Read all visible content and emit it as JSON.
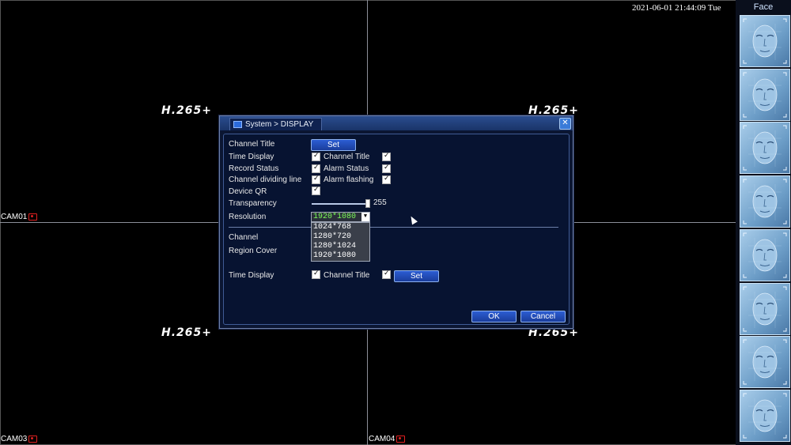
{
  "clock": "2021-06-01 21:44:09 Tue",
  "codec_label": "H.265+",
  "cameras": [
    "CAM01",
    "CAM03",
    "CAM04"
  ],
  "face_panel": {
    "title": "Face",
    "count": 8
  },
  "dialog": {
    "title": "System > DISPLAY",
    "rows": {
      "channel_title": "Channel Title",
      "set_label": "Set",
      "time_display": "Time Display",
      "channel_title_2": "Channel Title",
      "record_status": "Record Status",
      "alarm_status": "Alarm Status",
      "channel_dividing_line": "Channel dividing line",
      "alarm_flashing": "Alarm flashing",
      "device_qr": "Device QR",
      "transparency": "Transparency",
      "transparency_value": "255",
      "transparency_level": 1.0,
      "resolution": "Resolution",
      "resolution_value": "1920*1080",
      "resolution_options": [
        "1024*768",
        "1280*720",
        "1280*1024",
        "1920*1080"
      ],
      "channel": "Channel",
      "region_cover": "Region Cover",
      "time_display_2": "Time Display",
      "channel_title_3": "Channel Title",
      "set_label_2": "Set"
    },
    "ok_label": "OK",
    "cancel_label": "Cancel"
  }
}
